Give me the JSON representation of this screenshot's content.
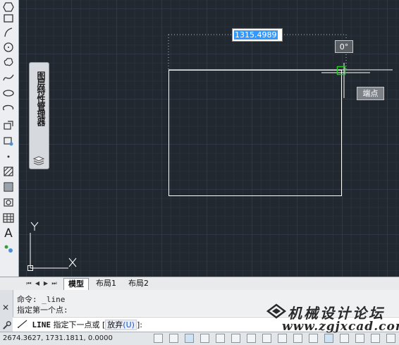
{
  "toolbar": {
    "tools": [
      "polygon-icon",
      "rectangle-icon",
      "arc-icon",
      "circle-icon",
      "revision-cloud-icon",
      "spline-icon",
      "ellipse-icon",
      "ellipse-arc-icon",
      "insert-block-icon",
      "make-block-icon",
      "point-icon",
      "hatch-icon",
      "gradient-icon",
      "region-icon",
      "table-icon",
      "multiline-text-icon",
      "add-selected-icon"
    ],
    "text_tool_glyph": "A"
  },
  "palette": {
    "title": "图层特性管理器"
  },
  "drawing": {
    "dimension_value": "1315.4989",
    "angle_tooltip": "0°",
    "snap_tooltip": "端点",
    "ucs": {
      "x_label": "X",
      "y_label": "Y"
    }
  },
  "tabs": {
    "items": [
      "模型",
      "布局1",
      "布局2"
    ],
    "active": "模型"
  },
  "command": {
    "history": [
      "命令: _line",
      "指定第一个点:"
    ],
    "close_glyph": "✕",
    "prompt_command": "LINE",
    "prompt_text": "指定下一点或",
    "option_open": "[",
    "option_label": "放弃",
    "option_key": "(U)",
    "option_close": "]:"
  },
  "status": {
    "coordinates": "2674.3627, 1731.1811, 0.0000"
  },
  "watermark": {
    "line1": "机械设计论坛",
    "line2": "www.zgjxcad.com"
  },
  "colors": {
    "canvas": "#212830",
    "selection": "#3399ff",
    "snap_marker": "#22cc22"
  }
}
